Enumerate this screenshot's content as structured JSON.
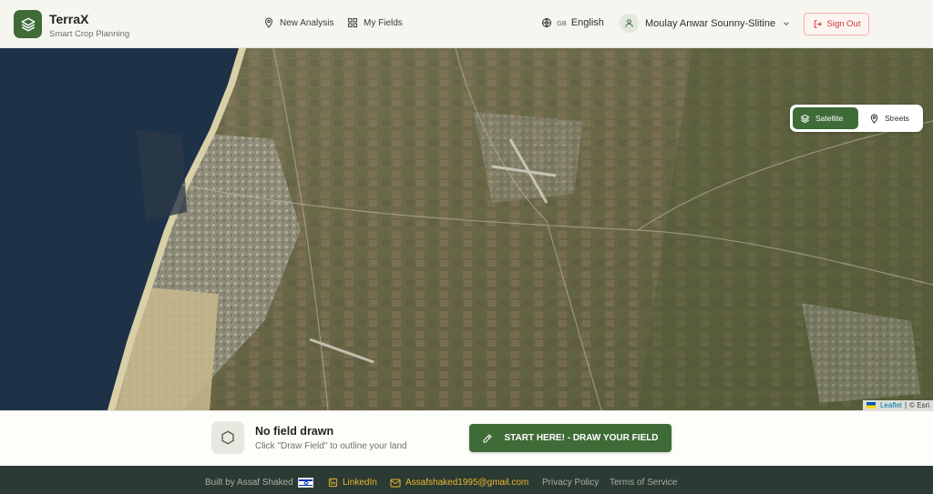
{
  "brand": {
    "name": "TerraX",
    "tagline": "Smart Crop Planning",
    "accent": "#3f6b37"
  },
  "nav": {
    "items": [
      {
        "label": "New Analysis",
        "icon": "map-pin-icon"
      },
      {
        "label": "My Fields",
        "icon": "grid-icon"
      }
    ]
  },
  "language": {
    "code": "GB",
    "label": "English"
  },
  "user": {
    "name": "Moulay Anwar Sounny-Slitine"
  },
  "signout": {
    "label": "Sign Out",
    "color": "#c9392b"
  },
  "map": {
    "layers": [
      {
        "label": "Satellite",
        "active": true
      },
      {
        "label": "Streets",
        "active": false
      }
    ],
    "attribution": {
      "leaflet": "Leaflet",
      "separator": "|",
      "provider": "© Esri"
    }
  },
  "field_panel": {
    "title": "No field drawn",
    "subtitle": "Click \"Draw Field\" to outline your land",
    "button": "START HERE! - DRAW YOUR FIELD"
  },
  "footer": {
    "built_by": "Built by Assaf Shaked",
    "linkedin": "LinkedIn",
    "email": "Assafshaked1995@gmail.com",
    "privacy": "Privacy Policy",
    "terms": "Terms of Service",
    "link_color": "#e8b730"
  }
}
